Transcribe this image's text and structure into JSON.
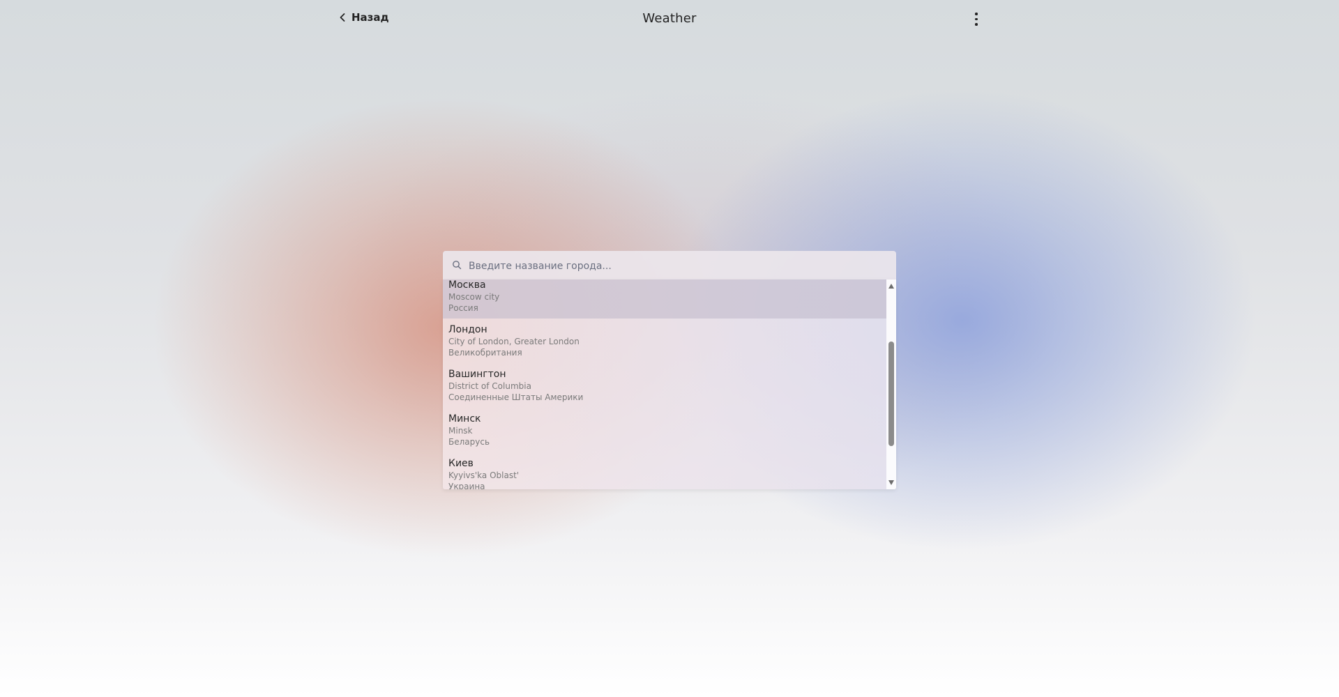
{
  "header": {
    "back_label": "Назад",
    "title": "Weather"
  },
  "icons": {
    "back": "chevron-left-icon",
    "menu": "more-vertical-icon",
    "search": "search-icon"
  },
  "search": {
    "placeholder": "Введите название города...",
    "value": ""
  },
  "results": [
    {
      "name": "Москва",
      "region": "Moscow city",
      "country": "Россия",
      "selected": true
    },
    {
      "name": "Лондон",
      "region": "City of London, Greater London",
      "country": "Великобритания",
      "selected": false
    },
    {
      "name": "Вашингтон",
      "region": "District of Columbia",
      "country": "Соединенные Штаты Америки",
      "selected": false
    },
    {
      "name": "Минск",
      "region": "Minsk",
      "country": "Беларусь",
      "selected": false
    },
    {
      "name": "Киев",
      "region": "Kyyivs'ka Oblast'",
      "country": "Украина",
      "selected": false
    }
  ],
  "colors": {
    "selected_row": "#c8c0cc",
    "scroll_thumb": "#8b8b8b",
    "warm_glow": "#d68c78",
    "cool_glow": "#8ca0dc"
  }
}
